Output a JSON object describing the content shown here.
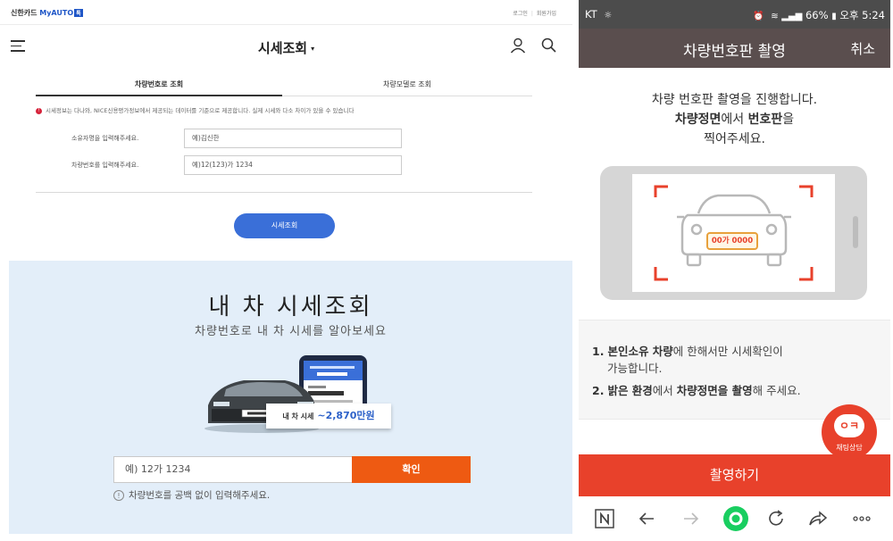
{
  "left": {
    "brand": {
      "card": "신한카드",
      "myauto": "MyAUTO",
      "badge": "톡"
    },
    "toplinks": {
      "login": "로그인",
      "signup": "회원가입"
    },
    "header": {
      "title": "시세조회"
    },
    "tabs": [
      {
        "label": "차량번호로 조회",
        "active": true
      },
      {
        "label": "차량모델로 조회",
        "active": false
      }
    ],
    "notice": "시세정보는 다나와, NICE신용평가정보에서 제공되는 데이터를 기준으로 제공합니다. 실제 시세와 다소 차이가 있을 수 있습니다",
    "form": {
      "owner_label": "소유자명을 입력해주세요.",
      "owner_placeholder": "예)김신한",
      "plate_label": "차량번호를 입력해주세요.",
      "plate_placeholder": "예)12(123)가 1234"
    },
    "search_button": "시세조회",
    "promo": {
      "title": "내 차 시세조회",
      "subtitle": "차량번호로 내 차 시세를 알아보세요",
      "result_label": "내 차 시세",
      "result_value": "~2,870만원",
      "input_placeholder": "예) 12가 1234",
      "confirm_button": "확인",
      "hint": "차량번호를 공백 없이 입력해주세요."
    }
  },
  "right": {
    "status_bar": {
      "carrier": "KT",
      "battery": "66%",
      "time": "오후 5:24"
    },
    "app_bar": {
      "title": "차량번호판 촬영",
      "cancel": "취소"
    },
    "intro": {
      "line1": "차량 번호판 촬영을 진행합니다.",
      "line2_bold1": "차량정면",
      "line2_mid": "에서 ",
      "line2_bold2": "번호판",
      "line2_end": "을",
      "line3": "찍어주세요."
    },
    "plate_sample": "00가 0000",
    "instructions": [
      {
        "num": "1.",
        "bold": "본인소유 차량",
        "rest": "에 한해서만 시세확인이",
        "line2": "가능합니다."
      },
      {
        "num": "2.",
        "bold1": "밝은 환경",
        "mid": "에서 ",
        "bold2": "차량정면을 촬영",
        "end": "해 주세요."
      }
    ],
    "shoot_button": "촬영하기",
    "chat_button": "채팅상담",
    "colors": {
      "accent": "#e8412b",
      "appbar": "#5a4e4e",
      "primary_blue": "#3a6fd8",
      "confirm_orange": "#ee5a12"
    }
  }
}
